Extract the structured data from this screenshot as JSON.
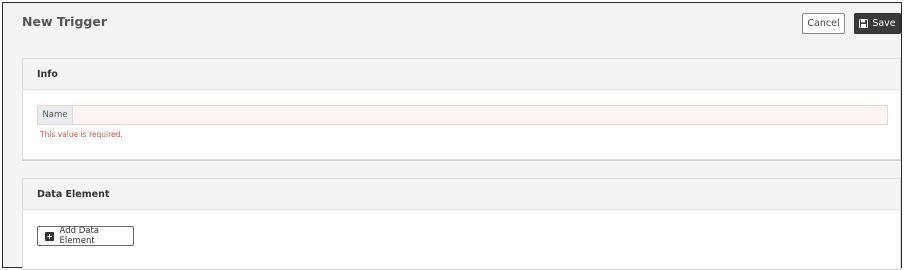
{
  "header": {
    "title": "New Trigger",
    "cancel_label": "Cancel",
    "save_label": "Save",
    "save_icon": "floppy-disk-icon"
  },
  "info_panel": {
    "title": "Info",
    "name_label": "Name",
    "name_value": "",
    "name_placeholder": "",
    "error": "This value is required.",
    "error_color": "#d9534f"
  },
  "data_element_panel": {
    "title": "Data Element",
    "add_label": "Add Data Element",
    "add_icon": "plus-square-icon"
  }
}
